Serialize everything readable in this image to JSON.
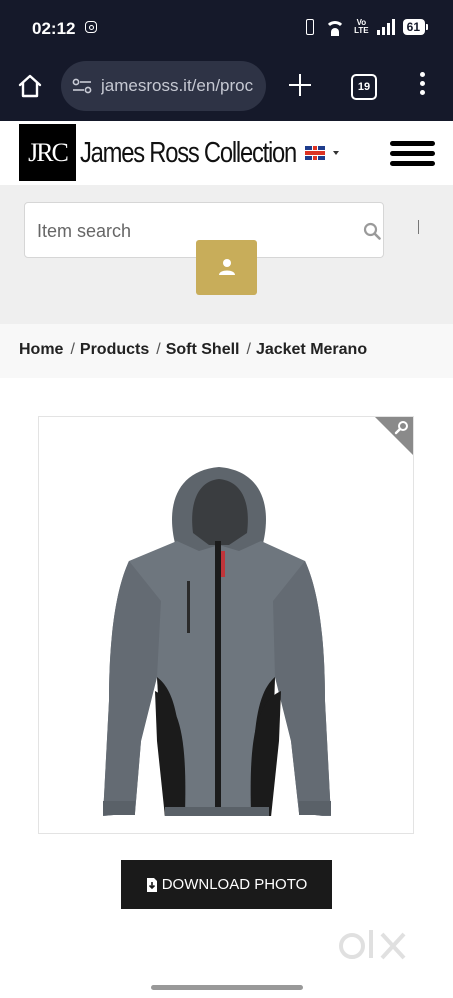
{
  "status_bar": {
    "time": "02:12",
    "volte": "Vo\nLTE",
    "battery": "61"
  },
  "browser": {
    "url": "jamesross.it/en/proc",
    "tab_count": "19"
  },
  "site_header": {
    "logo_mark": "JRC",
    "logo_text": "James Ross Collection",
    "language": "English (UK flag)"
  },
  "search": {
    "placeholder": "Item search"
  },
  "breadcrumb": {
    "items": [
      "Home",
      "Products",
      "Soft Shell",
      "Jacket Merano"
    ]
  },
  "product": {
    "image_alt": "Jacket Merano",
    "download_label": "DOWNLOAD PHOTO"
  },
  "colors": {
    "status_bg": "#15192a",
    "accent_gold": "#c8ad5a",
    "jacket_grey": "#6e767e",
    "jacket_black": "#1b1b1b"
  }
}
